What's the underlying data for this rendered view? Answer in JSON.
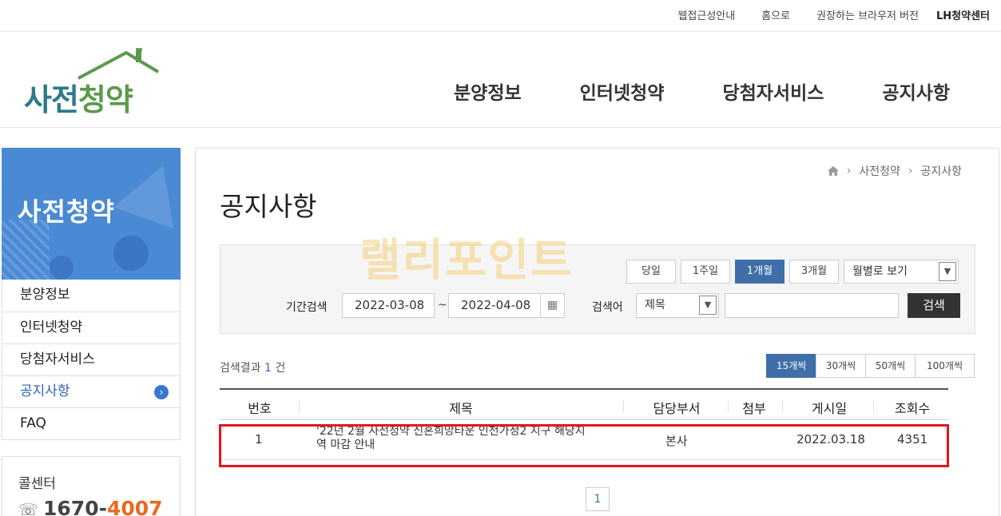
{
  "util_links": [
    "웹접근성안내",
    "홈으로",
    "권장하는 브라우저 버전",
    "LH청약센터"
  ],
  "logo": {
    "part1": "사전",
    "part2": "청약"
  },
  "gnb": [
    "분양정보",
    "인터넷청약",
    "당첨자서비스",
    "공지사항"
  ],
  "side": {
    "title": "사전청약",
    "menu": [
      "분양정보",
      "인터넷청약",
      "당첨자서비스",
      "공지사항",
      "FAQ"
    ],
    "active_index": 3,
    "callcenter": {
      "label": "콜센터",
      "num_prefix": "1670-",
      "num_suffix": "4007"
    }
  },
  "breadcrumb": [
    "사전청약",
    "공지사항"
  ],
  "page_title": "공지사항",
  "watermark": "랠리포인트",
  "search": {
    "period_buttons": [
      "당일",
      "1주일",
      "1개월",
      "3개월"
    ],
    "period_selected_index": 2,
    "monthly_view": "월별로 보기",
    "period_label": "기간검색",
    "date_from": "2022-03-08",
    "date_to": "2022-04-08",
    "tilde": "~",
    "keyword_label": "검색어",
    "field_select": "제목",
    "keyword_value": "",
    "search_button": "검색"
  },
  "result": {
    "prefix": "검색결과",
    "count": "1",
    "suffix": "건"
  },
  "per_page": {
    "options": [
      "15개씩",
      "30개씩",
      "50개씩",
      "100개씩"
    ],
    "selected_index": 0
  },
  "table": {
    "headers": [
      "번호",
      "제목",
      "담당부서",
      "첨부",
      "게시일",
      "조회수"
    ],
    "rows": [
      {
        "no": "1",
        "title_line1": "'22년 2월 사전청약 신혼희망타운 인천가정2 지구 해당지",
        "title_line2": "역 마감 안내",
        "dept": "본사",
        "attach": "",
        "date": "2022.03.18",
        "views": "4351"
      }
    ]
  },
  "pagination": [
    "1"
  ],
  "colors": {
    "accent": "#3e6fa8",
    "side_banner": "#4a8ad4",
    "highlight": "#e6141c",
    "callcenter_orange": "#e86b1f"
  }
}
